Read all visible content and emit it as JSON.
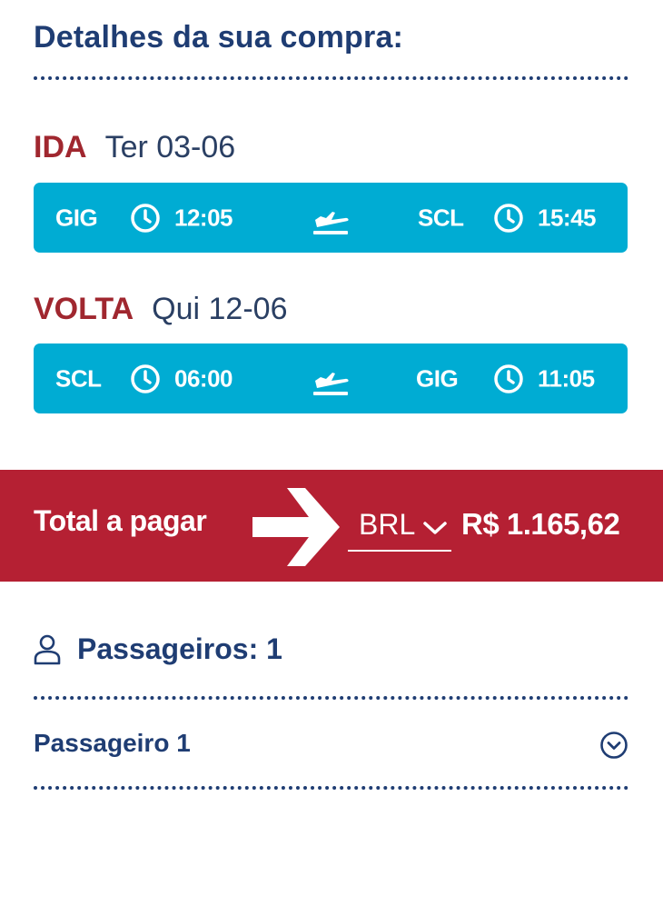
{
  "summary": {
    "title": "Detalhes da sua compra:"
  },
  "legs": [
    {
      "kind": "IDA",
      "date": "Ter 03-06",
      "origin": "GIG",
      "departure": "12:05",
      "destination": "SCL",
      "arrival": "15:45"
    },
    {
      "kind": "VOLTA",
      "date": "Qui 12-06",
      "origin": "SCL",
      "departure": "06:00",
      "destination": "GIG",
      "arrival": "11:05"
    }
  ],
  "total": {
    "label": "Total a pagar",
    "currency": "BRL",
    "amount": "R$ 1.165,62"
  },
  "passengers": {
    "title": "Passageiros: 1",
    "items": [
      {
        "label": "Passageiro 1"
      }
    ]
  },
  "icons": {
    "clock": "clock-icon",
    "plane": "plane-takeoff-icon",
    "user": "user-icon",
    "chevron": "chevron-down-icon",
    "expand": "chevron-down-circle-icon",
    "arrow": "arrow-right-icon"
  },
  "colors": {
    "navy": "#1f3d73",
    "flight_bar": "#00acd3",
    "total_band": "#b52033",
    "leg_label": "#a0272f"
  }
}
